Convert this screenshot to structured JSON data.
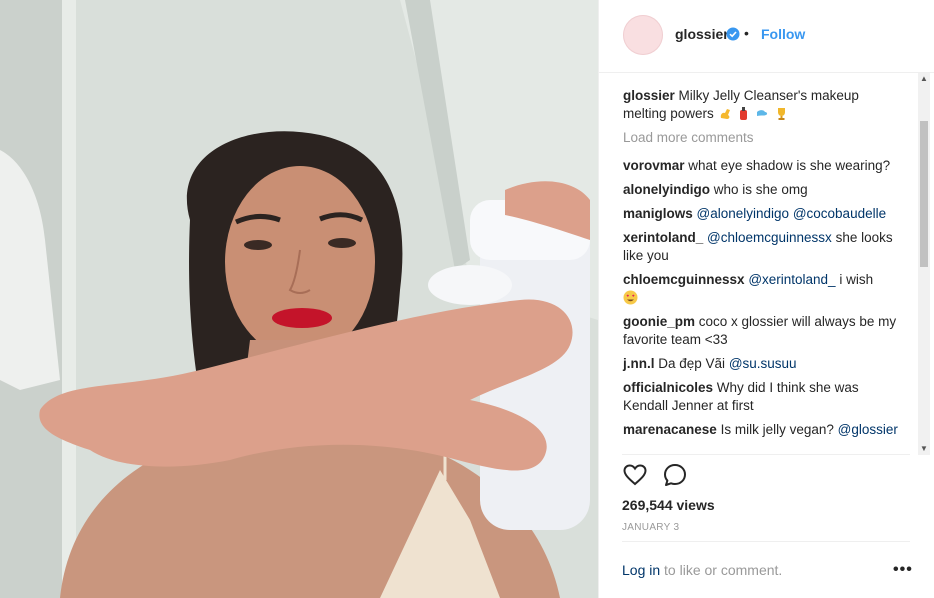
{
  "header": {
    "username": "glossier",
    "separator": "•",
    "follow_label": "Follow"
  },
  "caption": {
    "user": "glossier",
    "text": "Milky Jelly Cleanser's makeup melting powers",
    "emojis": [
      "flexed-biceps",
      "fire-extinguisher",
      "dash",
      "trophy"
    ]
  },
  "load_more": "Load more comments",
  "comments": [
    {
      "user": "vorovmar",
      "text": "what eye shadow is she wearing?"
    },
    {
      "user": "alonelyindigo",
      "text": "who is she omg"
    },
    {
      "user": "maniglows",
      "mention1": "@alonelyindigo",
      "mention2": "@cocobaudelle"
    },
    {
      "user": "xerintoland_",
      "mention": "@chloemcguinnessx",
      "text": "she looks like you"
    },
    {
      "user": "chloemcguinnessx",
      "mention": "@xerintoland_",
      "text": "i wish",
      "emoji": "smiling-face-with-heart-eyes"
    },
    {
      "user": "goonie_pm",
      "text": "coco x glossier will always be my favorite team <33"
    },
    {
      "user": "j.nn.l",
      "text": "Da đẹp Vãi",
      "mention": "@su.susuu"
    },
    {
      "user": "officialnicoles",
      "text": "Why did I think she was Kendall Jenner at first"
    },
    {
      "user": "marenacanese",
      "text": "Is milk jelly vegan?",
      "mention": "@glossier"
    }
  ],
  "views": "269,544 views",
  "date": "JANUARY 3",
  "login": {
    "link": "Log in",
    "rest": "to like or comment."
  },
  "more_label": "•••",
  "icons": {
    "verified": "verified-badge-icon",
    "like": "heart-icon",
    "comment": "speech-bubble-icon"
  },
  "colors": {
    "link_blue": "#3897f0",
    "mention": "#003569",
    "muted": "#999999",
    "avatar_pink": "#f9dfe1"
  }
}
